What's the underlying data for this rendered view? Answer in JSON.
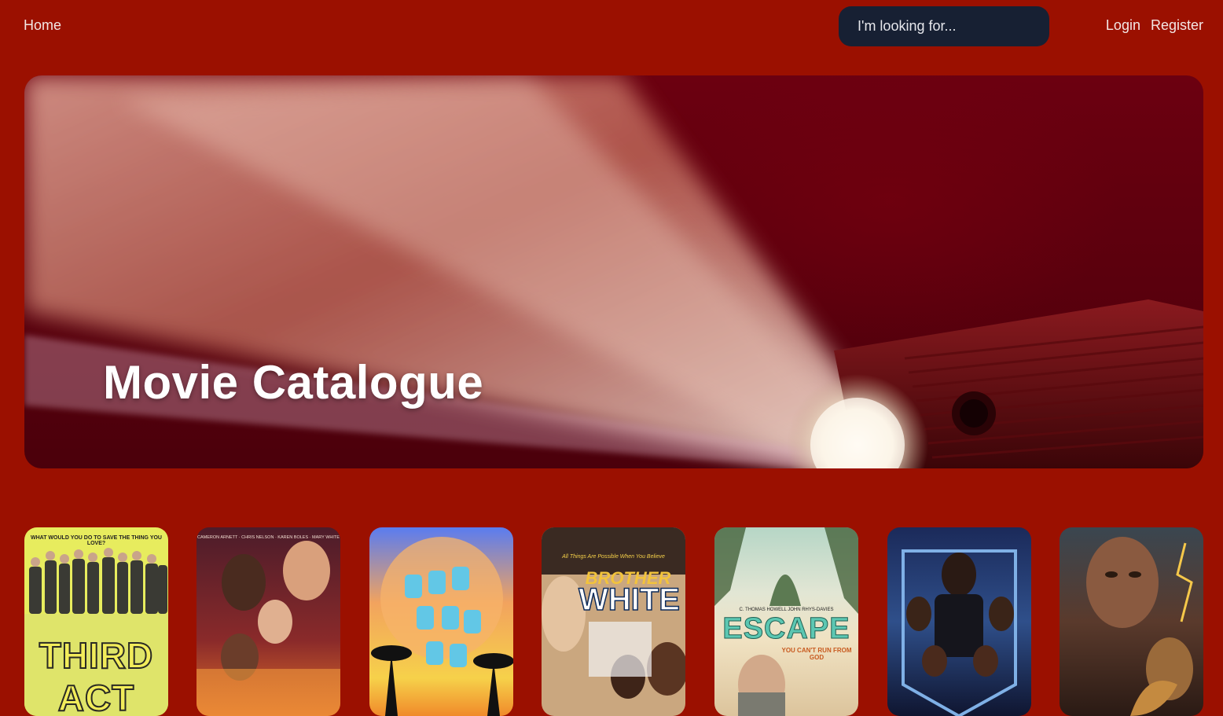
{
  "nav": {
    "home_label": "Home",
    "login_label": "Login",
    "register_label": "Register"
  },
  "search": {
    "placeholder": "I'm looking for..."
  },
  "hero": {
    "title": "Movie Catalogue"
  },
  "posters": [
    {
      "tagline": "WHAT WOULD YOU DO TO SAVE THE THING YOU LOVE?",
      "title": "THIRD ACT"
    },
    {
      "credits": "CAMERON ARNETT · CHRIS NELSON · KAREN BOLES · MARY WHITE"
    },
    {},
    {
      "tagline": "All Things Are Possible When You Believe",
      "title_top": "BROTHER",
      "title_bottom": "WHITE"
    },
    {
      "credits": "C. THOMAS HOWELL   JOHN RHYS-DAVIES",
      "title": "ESCAPE",
      "tagline": "YOU CAN'T RUN FROM GOD"
    },
    {},
    {}
  ],
  "colors": {
    "background": "#9b1000",
    "search_bg": "#172033",
    "hero_dark": "#5b000d"
  }
}
